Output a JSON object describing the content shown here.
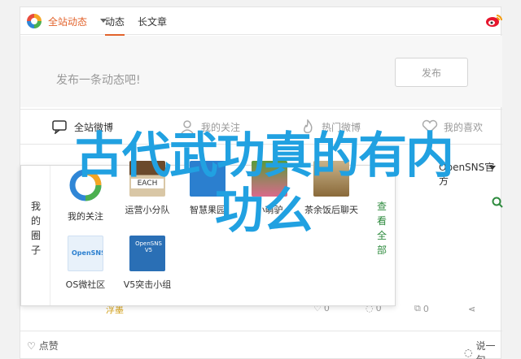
{
  "topbar": {
    "site_dropdown": "全站动态",
    "tabs": [
      {
        "label": "动态"
      },
      {
        "label": "长文章"
      }
    ],
    "logo_icon": "pinwheel-icon",
    "weibo_icon": "weibo-icon"
  },
  "compose": {
    "placeholder": "发布一条动态吧!",
    "post_button": "发布"
  },
  "filters": [
    {
      "label": "全站微博",
      "icon": "speech-bubble-icon"
    },
    {
      "label": "我的关注",
      "icon": "person-icon"
    },
    {
      "label": "热门微博",
      "icon": "flame-icon"
    },
    {
      "label": "我的喜欢",
      "icon": "heart-icon"
    }
  ],
  "sns_link": "OpenSNS官方",
  "popup": {
    "side_label": "我的圈子",
    "view_all": "查看全部",
    "items": [
      {
        "label": "我的关注"
      },
      {
        "label": "运营小分队"
      },
      {
        "label": "智慧果园"
      },
      {
        "label": "小萌驴"
      },
      {
        "label": "茶余饭后聊天"
      },
      {
        "label": "OS微社区"
      },
      {
        "label": "V5突击小组"
      }
    ]
  },
  "feed": {
    "user": "浮墨",
    "likes": "0",
    "comments": "0",
    "reposts": "0"
  },
  "bottom": {
    "like_label": "点赞",
    "comment_label": "说一句"
  },
  "overlay": {
    "line1": "古代武功真的有内",
    "line2": "功么"
  },
  "colors": {
    "accent": "#e2632c",
    "overlay_text": "#21a1e1",
    "view_all": "#2e8b3e"
  }
}
